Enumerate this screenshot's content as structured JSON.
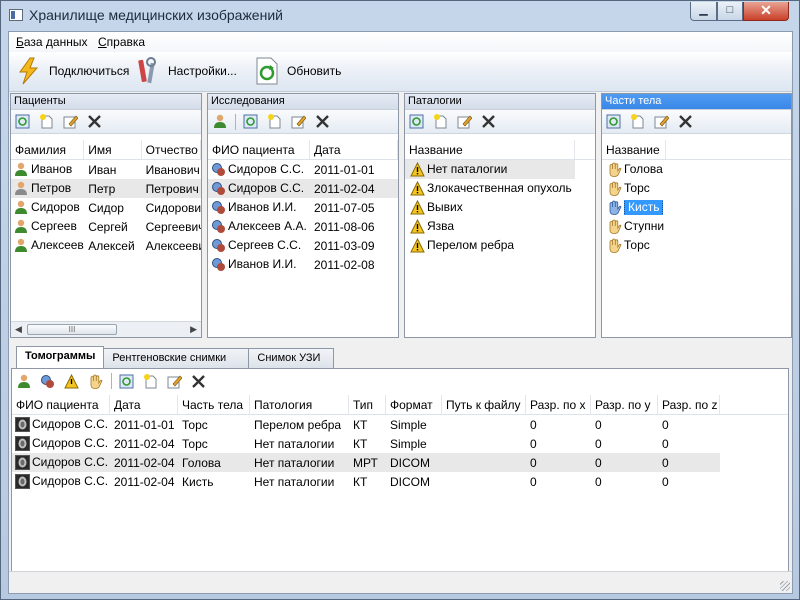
{
  "window": {
    "title": "Хранилище медицинских изображений",
    "min": "▁",
    "max": "□",
    "close": "✕"
  },
  "menu": [
    "База данных",
    "Справка"
  ],
  "menu_underline": [
    "Б",
    "С"
  ],
  "menu_rest": [
    "аза данных",
    "правка"
  ],
  "toolbar": {
    "connect": "Подключиться",
    "settings": "Настройки...",
    "refresh": "Обновить"
  },
  "patients": {
    "title": "Пациенты",
    "columns": [
      "Фамилия",
      "Имя",
      "Отчество"
    ],
    "rows": [
      [
        "Иванов",
        "Иван",
        "Иванович"
      ],
      [
        "Петров",
        "Петр",
        "Петрович"
      ],
      [
        "Сидоров",
        "Сидор",
        "Сидорович"
      ],
      [
        "Сергеев",
        "Сергей",
        "Сергеевич"
      ],
      [
        "Алексеев",
        "Алексей",
        "Алексеевич"
      ]
    ],
    "scroll_thumb": "III"
  },
  "studies": {
    "title": "Исследования",
    "columns": [
      "ФИО пациента",
      "Дата"
    ],
    "rows": [
      [
        "Сидоров С.С.",
        "2011-01-01"
      ],
      [
        "Сидоров С.С.",
        "2011-02-04"
      ],
      [
        "Иванов И.И.",
        "2011-07-05"
      ],
      [
        "Алексеев А.А.",
        "2011-08-06"
      ],
      [
        "Сергеев С.С.",
        "2011-03-09"
      ],
      [
        "Иванов И.И.",
        "2011-02-08"
      ]
    ]
  },
  "pathologies": {
    "title": "Паталогии",
    "columns": [
      "Название"
    ],
    "rows": [
      "Нет паталогии",
      "Злокачественная опухоль",
      "Вывих",
      "Язва",
      "Перелом ребра"
    ]
  },
  "bodyparts": {
    "title": "Части тела",
    "columns": [
      "Название"
    ],
    "rows": [
      "Голова",
      "Торс",
      "Кисть",
      "Ступни",
      "Торс"
    ]
  },
  "tabs": [
    "Томограммы",
    "Рентгеновские снимки",
    "Снимок УЗИ"
  ],
  "images": {
    "columns": [
      "ФИО пациента",
      "Дата",
      "Часть тела",
      "Патология",
      "Тип",
      "Формат",
      "Путь к файлу",
      "Разр. по x",
      "Разр. по y",
      "Разр. по z"
    ],
    "rows": [
      [
        "Сидоров С.С.",
        "2011-01-01",
        "Торс",
        "Перелом ребра",
        "КТ",
        "Simple",
        "",
        "0",
        "0",
        "0"
      ],
      [
        "Сидоров С.С.",
        "2011-02-04",
        "Торс",
        "Нет паталогии",
        "КТ",
        "Simple",
        "",
        "0",
        "0",
        "0"
      ],
      [
        "Сидоров С.С.",
        "2011-02-04",
        "Голова",
        "Нет паталогии",
        "МРТ",
        "DICOM",
        "",
        "0",
        "0",
        "0"
      ],
      [
        "Сидоров С.С.",
        "2011-02-04",
        "Кисть",
        "Нет паталогии",
        "КТ",
        "DICOM",
        "",
        "0",
        "0",
        "0"
      ]
    ]
  },
  "colors": {
    "accent": "#3a86e8",
    "selection": "#3399ff"
  }
}
